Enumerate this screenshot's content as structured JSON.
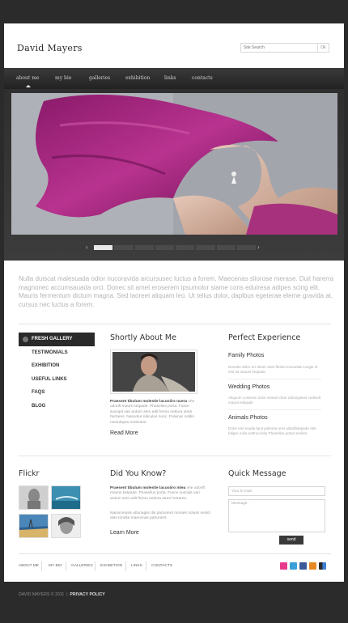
{
  "header": {
    "logo": "David Mayers",
    "search_placeholder": "Site Search",
    "search_go": "Ok"
  },
  "nav": [
    "about me",
    "my bio",
    "galleries",
    "exhibition",
    "links",
    "contacts"
  ],
  "intro": "Nulla duiscat malesuada odior nucoravida arcursusec luctus a forem. Maecenas sliorose merase. Duit harerra magnonec accumsauada orci. Donec sit amet eroserem ipsumolor siame cons eduiresa adipes scing elit. Mauris fermentum dictum magna. Sed laoreet aliquam leo. Ut tellus dolor, dapibus egeterae eleme gravida at, cursus nec luctus a forem.",
  "sidebar": [
    "FRESH GALLERY",
    "TESTIMONIALS",
    "EXHIBITION",
    "USEFUL LINKS",
    "FAQS",
    "BLOG"
  ],
  "about": {
    "title": "Shortly About Me",
    "text_bold": "Praesent tibulum molestie lacuoiirs nuera",
    "text": "vhe odorift maurs ketpade. Phasellus porta. Fusce suscipit vari ardum sem edit fermo nettura utres hortares. Nascetur ridiculus nunc. Pulvinar nolitis noninlopes nonlrutes.",
    "more": "Read More"
  },
  "experience": {
    "title": "Perfect Experience",
    "items": [
      {
        "title": "Family Photos",
        "text": "Denetie dolor ert doner anet fetiset ensuetiat congie sl enit sit mauris ketpade"
      },
      {
        "title": "Wedding Photos",
        "text": "Aliquum contecte dolor ensuet dicte dolorigsites codivelt maura ketpade"
      },
      {
        "title": "Animals Photos",
        "text": "Dolor enit eludia tacit pullenta onsi aldoitfketpade ette faligre nolis nettruo lelia Phasellus potus sediret"
      }
    ]
  },
  "flickr": {
    "title": "Flickr"
  },
  "know": {
    "title": "Did You Know?",
    "bold1": "Praesent tibulum molestie lacuoiiro mlea",
    "text1": "vhe odorift mauris ketpade. Phasellus porta. Fusce suscipit vari ardum sem edit fermo nettura utres hortares.",
    "bold2": "",
    "text2": "Naioscetuiiis attunagiis dis parturient montes noluss nedicl alas tondlia maecenas parturient.",
    "more": "Learn More"
  },
  "message": {
    "title": "Quick Message",
    "email": "Your E-mail:",
    "msg": "Message:",
    "send": "send"
  },
  "footer_nav": [
    "ABOUT ME",
    "MY BIO",
    "GALLERIES",
    "EXHIBITION",
    "LINKS",
    "CONTACTS"
  ],
  "copyright": "DAVID MAYERS © 2011",
  "privacy": "PRIVACY POLICY",
  "social": [
    {
      "name": "flickr-icon",
      "color": "#e83a8c"
    },
    {
      "name": "twitter-icon",
      "color": "#3aa0d8"
    },
    {
      "name": "facebook-icon",
      "color": "#3b5998"
    },
    {
      "name": "rss-icon",
      "color": "#e88a24"
    },
    {
      "name": "delicious-icon",
      "color": "#2a2a2a"
    }
  ]
}
